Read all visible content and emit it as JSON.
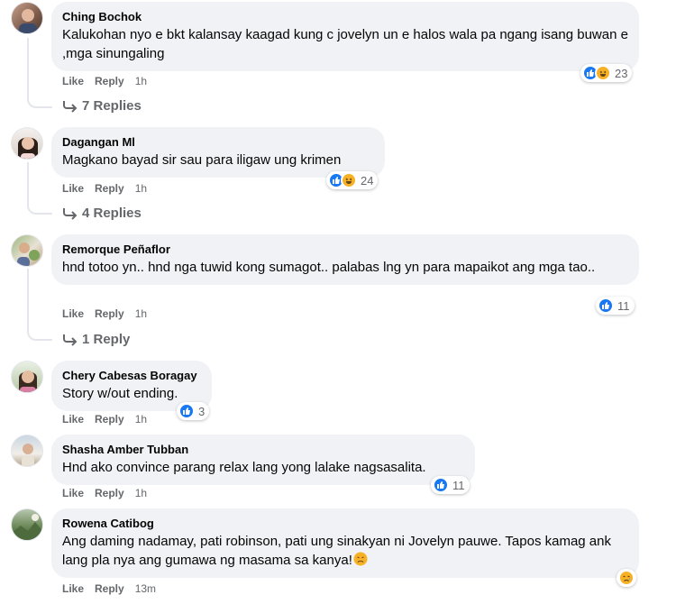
{
  "labels": {
    "like": "Like",
    "reply": "Reply"
  },
  "comments": [
    {
      "author": "Ching Bochok",
      "text": "Kalukohan nyo e bkt kalansay kaagad kung c jovelyn un e halos wala pa ngang isang buwan e ,mga sinungaling",
      "time": "1h",
      "reactions": [
        "like-icon",
        "haha-icon"
      ],
      "reaction_count": "23",
      "replies": "7 Replies"
    },
    {
      "author": "Dagangan Ml",
      "text": "Magkano bayad sir sau para iligaw ung krimen",
      "time": "1h",
      "reactions": [
        "like-icon",
        "haha-icon"
      ],
      "reaction_count": "24",
      "replies": "4 Replies"
    },
    {
      "author": "Remorque Peñaflor",
      "text": "hnd totoo yn.. hnd nga tuwid kong sumagot.. palabas lng yn para mapaikot ang mga tao..",
      "time": "1h",
      "reactions": [
        "like-icon"
      ],
      "reaction_count": "11",
      "replies": "1 Reply"
    },
    {
      "author": "Chery Cabesas Boragay",
      "text": "Story w/out ending.",
      "time": "1h",
      "reactions": [
        "like-icon"
      ],
      "reaction_count": "3"
    },
    {
      "author": "Shasha Amber Tubban",
      "text": "Hnd ako convince parang relax lang yong lalake nagsasalita.",
      "time": "1h",
      "reactions": [
        "like-icon"
      ],
      "reaction_count": "11"
    },
    {
      "author": "Rowena Catibog",
      "text": "Ang daming nadamay, pati robinson, pati ung sinakyan ni Jovelyn pauwe. Tapos kamag ank lang pla nya ang gumawa ng masama sa kanya!",
      "text_emoji": "disappointed-face-icon",
      "time": "13m",
      "reactions": [
        "sad-icon"
      ]
    }
  ]
}
